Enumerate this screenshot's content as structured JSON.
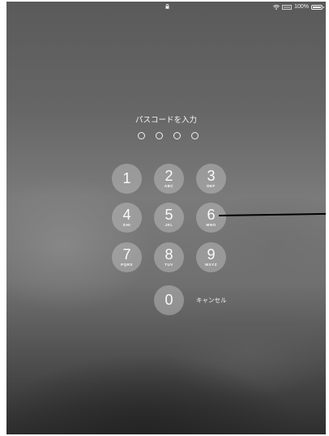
{
  "status_bar": {
    "lock_icon": "lock-icon",
    "wifi_icon": "wifi-icon",
    "battery_percent": "100%",
    "battery_icon": "battery-icon"
  },
  "passcode": {
    "prompt": "パスコードを入力",
    "dot_count": 4
  },
  "keypad": {
    "keys": [
      {
        "digit": "1",
        "letters": ""
      },
      {
        "digit": "2",
        "letters": "ABC"
      },
      {
        "digit": "3",
        "letters": "DEF"
      },
      {
        "digit": "4",
        "letters": "GHI"
      },
      {
        "digit": "5",
        "letters": "JKL"
      },
      {
        "digit": "6",
        "letters": "MNO"
      },
      {
        "digit": "7",
        "letters": "PQRS"
      },
      {
        "digit": "8",
        "letters": "TUV"
      },
      {
        "digit": "9",
        "letters": "WXYZ"
      },
      {
        "digit": "0",
        "letters": ""
      }
    ],
    "cancel_label": "キャンセル"
  }
}
